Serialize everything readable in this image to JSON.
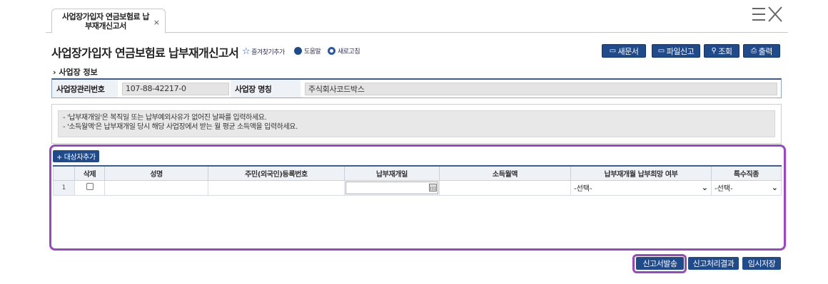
{
  "tab": {
    "label": "사업장가입자 연금보험료 납부재개신고서",
    "close": "×"
  },
  "header": {
    "title": "사업장가입자 연금보험료 납부재개신고서",
    "favorite": "즐겨찾기추가",
    "help": "도움말",
    "refresh": "새로고침"
  },
  "toolbar": {
    "new_doc": "새문서",
    "file_report": "파일신고",
    "search": "조회",
    "print": "출력"
  },
  "section": {
    "title": "› 사업장 정보"
  },
  "info": {
    "mgmt_no_label": "사업장관리번호",
    "mgmt_no_value": "107-88-42217-0",
    "name_label": "사업장 명칭",
    "name_value": "주식회사코드박스"
  },
  "notice": {
    "line1": "- '납부재개일'은 복직일 또는 납부예외사유가 없어진 날짜를 입력하세요.",
    "line2": "- '소득월액'은 납부재개일 당시 해당 사업장에서 받는 월 평균 소득액을 입력하세요."
  },
  "grid": {
    "add_button": "+ 대상자추가",
    "columns": [
      "",
      "삭제",
      "성명",
      "주민(외국인)등록번호",
      "납부재개일",
      "소득월액",
      "납부재개월 납부희망 여부",
      "특수직종"
    ],
    "rows": [
      {
        "num": "1",
        "hope_select": "-선택-",
        "special_select": "-선택-"
      }
    ]
  },
  "bottom": {
    "submit": "신고서발송",
    "result": "신고처리결과",
    "temp_save": "임시저장"
  }
}
